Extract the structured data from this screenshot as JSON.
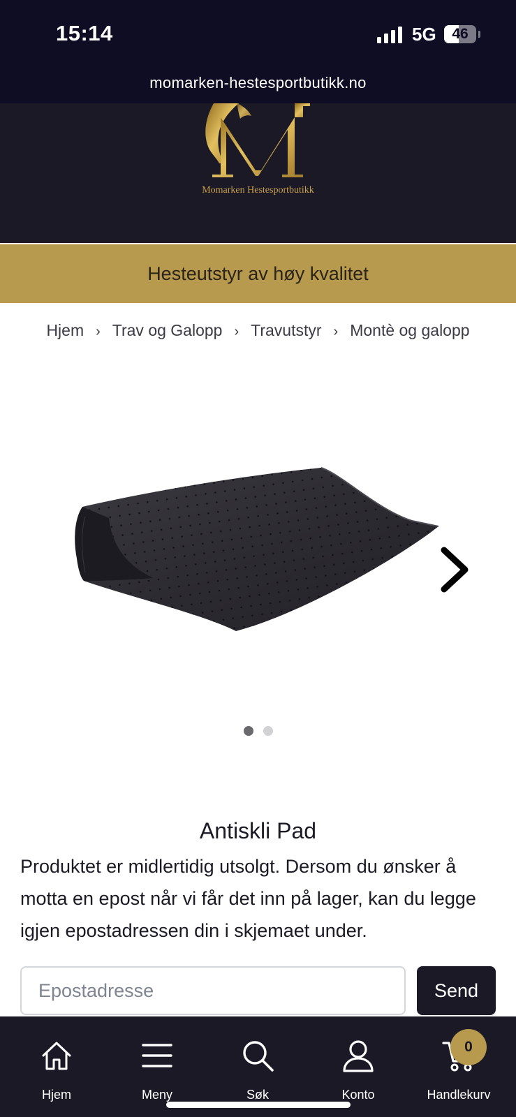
{
  "status": {
    "time": "15:14",
    "network": "5G",
    "battery": "46",
    "battery_level": 0.46
  },
  "browser": {
    "url": "momarken-hestesportbutikk.no"
  },
  "header": {
    "logo_text": "Momarken Hestesportbutikk",
    "tagline": "Hesteutstyr av høy kvalitet"
  },
  "breadcrumb": [
    "Hjem",
    "Trav og Galopp",
    "Travutstyr",
    "Montè og galopp"
  ],
  "gallery": {
    "slide_count": 2,
    "active_slide": 1,
    "next_icon": "chevron-right-icon"
  },
  "product": {
    "title": "Antiskli Pad",
    "out_of_stock_text": "Produktet er midlertidig utsolgt. Dersom du ønsker å motta en epost når vi får det inn på lager, kan du legge igjen epostadressen din i skjemaet under.",
    "email_placeholder": "Epostadresse",
    "email_value": "",
    "send_label": "Send"
  },
  "nav": {
    "home": "Hjem",
    "menu": "Meny",
    "search": "Søk",
    "account": "Konto",
    "cart": "Handlekurv",
    "cart_count": "0"
  },
  "colors": {
    "dark": "#1b1926",
    "status_bg": "#0f0d24",
    "gold": "#b79a4e",
    "logo_gold": "#c8a24e"
  }
}
